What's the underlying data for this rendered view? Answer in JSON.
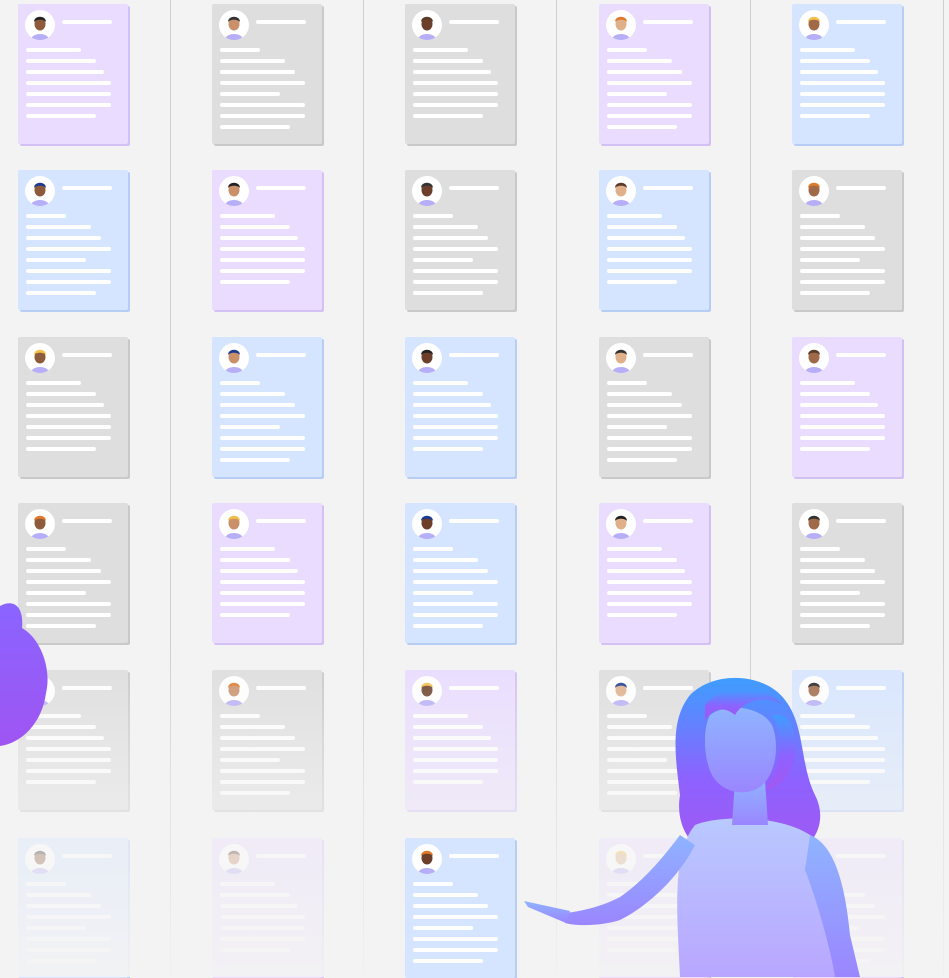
{
  "colors": {
    "purple_card": "#e9dcff",
    "blue_card": "#d6e5ff",
    "gray_card": "#dedede",
    "background": "#f3f3f3",
    "figure_gradient_top": "#4a9cff",
    "figure_gradient_bottom": "#9b59f5"
  },
  "grid": {
    "columns": 5,
    "rows": 6,
    "cards": [
      {
        "color": "purple",
        "avatar": "person-light-hair-icon"
      },
      {
        "color": "gray",
        "avatar": "person-long-hair-icon"
      },
      {
        "color": "gray",
        "avatar": "person-bald-beard-icon"
      },
      {
        "color": "purple",
        "avatar": "person-beard-icon"
      },
      {
        "color": "blue",
        "avatar": "person-long-hair-icon"
      },
      {
        "color": "blue",
        "avatar": "person-orange-hair-icon"
      },
      {
        "color": "purple",
        "avatar": "person-short-hair-icon"
      },
      {
        "color": "gray",
        "avatar": "person-short-hair-icon"
      },
      {
        "color": "blue",
        "avatar": "person-short-hair-icon"
      },
      {
        "color": "gray",
        "avatar": "person-long-hair-icon"
      },
      {
        "color": "gray",
        "avatar": "person-curly-hair-icon"
      },
      {
        "color": "blue",
        "avatar": "person-beard-icon"
      },
      {
        "color": "blue",
        "avatar": "person-beard-icon"
      },
      {
        "color": "gray",
        "avatar": "person-long-hair-icon"
      },
      {
        "color": "purple",
        "avatar": "person-headscarf-icon"
      },
      {
        "color": "gray",
        "avatar": "person-long-hair-icon"
      },
      {
        "color": "purple",
        "avatar": "person-beard-icon"
      },
      {
        "color": "blue",
        "avatar": "person-blonde-hair-icon"
      },
      {
        "color": "purple",
        "avatar": "person-turban-icon"
      },
      {
        "color": "gray",
        "avatar": "person-short-hair-icon"
      },
      {
        "color": "gray",
        "avatar": "person-short-hair-icon"
      },
      {
        "color": "gray",
        "avatar": "person-short-hair-icon"
      },
      {
        "color": "purple",
        "avatar": "person-curly-hair-icon"
      },
      {
        "color": "gray",
        "avatar": "person-long-hair-icon"
      },
      {
        "color": "blue",
        "avatar": "person-bald-beard-icon"
      },
      {
        "color": "blue",
        "avatar": "person-short-hair-icon"
      },
      {
        "color": "purple",
        "avatar": "person-short-hair-icon"
      },
      {
        "color": "blue",
        "avatar": "person-long-hair-icon"
      },
      {
        "color": "purple",
        "avatar": "person-short-hair-icon"
      },
      {
        "color": "purple",
        "avatar": "person-short-hair-icon"
      }
    ]
  },
  "illustration": {
    "figure": "woman-pointing-figure",
    "partial_figure": "partial-figure-left"
  }
}
